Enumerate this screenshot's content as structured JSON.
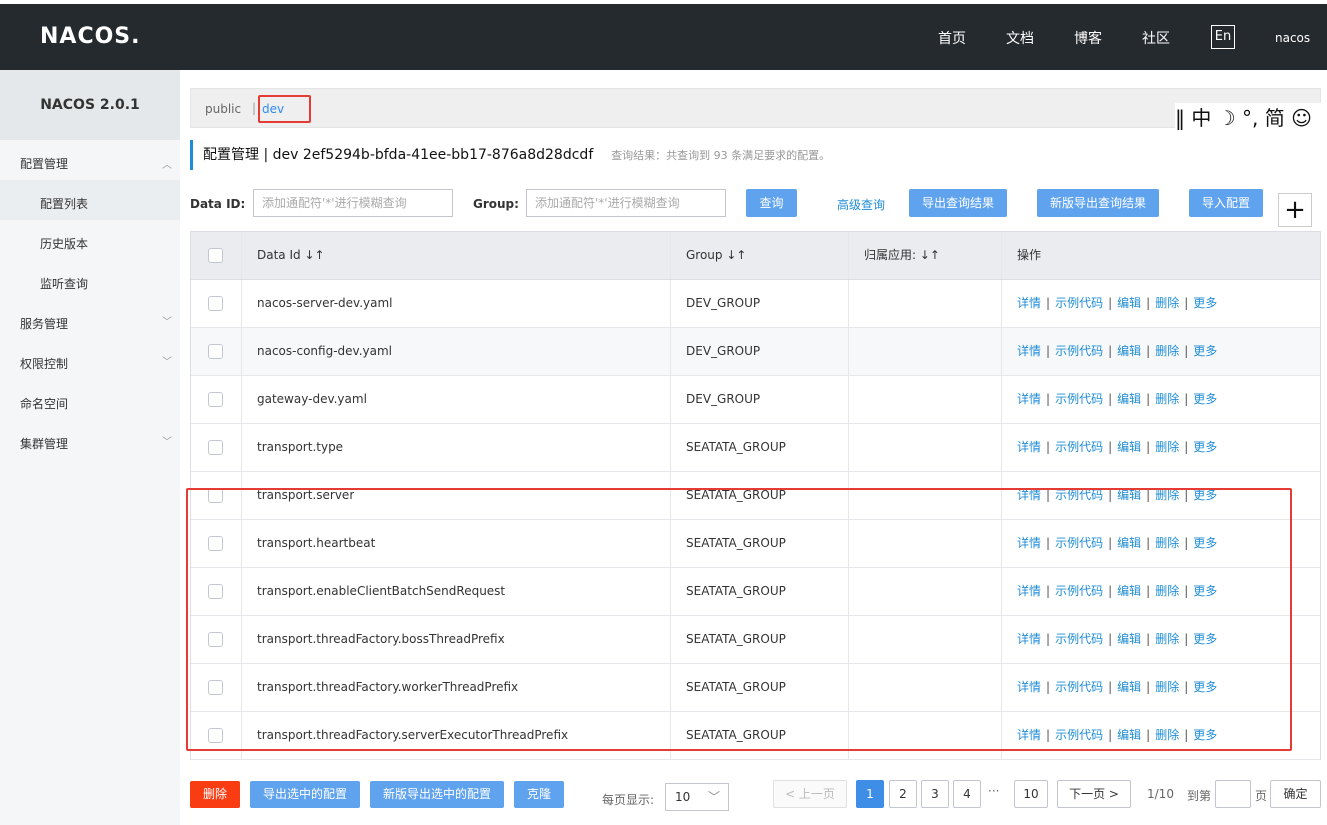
{
  "topbar": {
    "logo": "NACOS.",
    "nav": [
      "首页",
      "文档",
      "博客",
      "社区"
    ],
    "lang": "En",
    "user": "nacos"
  },
  "sidebar": {
    "version": "NACOS 2.0.1",
    "config_mgmt": "配置管理",
    "config_list": "配置列表",
    "history": "历史版本",
    "listen_query": "监听查询",
    "service_mgmt": "服务管理",
    "access_control": "权限控制",
    "namespace": "命名空间",
    "cluster_mgmt": "集群管理"
  },
  "namespaces": {
    "public": "public",
    "sep": "|",
    "dev": "dev"
  },
  "ime_toolbar": "‖ 中 ☽ °, 简 ☺",
  "title": {
    "main": "配置管理 | dev 2ef5294b-bfda-41ee-bb17-876a8d28dcdf",
    "hint": "查询结果：共查询到 93 条满足要求的配置。"
  },
  "search": {
    "dataid_label": "Data ID:",
    "dataid_placeholder": "添加通配符'*'进行模糊查询",
    "group_label": "Group:",
    "group_placeholder": "添加通配符'*'进行模糊查询",
    "query": "查询",
    "advanced": "高级查询",
    "export": "导出查询结果",
    "export_new": "新版导出查询结果",
    "import": "导入配置",
    "plus": "+"
  },
  "table": {
    "headers": {
      "dataid": "Data Id ↓↑",
      "group": "Group ↓↑",
      "app": "归属应用: ↓↑",
      "ops": "操作"
    },
    "op_labels": [
      "详情",
      "示例代码",
      "编辑",
      "删除",
      "更多"
    ],
    "rows": [
      {
        "dataid": "nacos-server-dev.yaml",
        "group": "DEV_GROUP"
      },
      {
        "dataid": "nacos-config-dev.yaml",
        "group": "DEV_GROUP"
      },
      {
        "dataid": "gateway-dev.yaml",
        "group": "DEV_GROUP"
      },
      {
        "dataid": "transport.type",
        "group": "SEATATA_GROUP"
      },
      {
        "dataid": "transport.server",
        "group": "SEATATA_GROUP"
      },
      {
        "dataid": "transport.heartbeat",
        "group": "SEATATA_GROUP"
      },
      {
        "dataid": "transport.enableClientBatchSendRequest",
        "group": "SEATATA_GROUP"
      },
      {
        "dataid": "transport.threadFactory.bossThreadPrefix",
        "group": "SEATATA_GROUP"
      },
      {
        "dataid": "transport.threadFactory.workerThreadPrefix",
        "group": "SEATATA_GROUP"
      },
      {
        "dataid": "transport.threadFactory.serverExecutorThreadPrefix",
        "group": "SEATATA_GROUP"
      }
    ]
  },
  "footer": {
    "delete": "删除",
    "export_selected": "导出选中的配置",
    "export_selected_new": "新版导出选中的配置",
    "clone": "克隆",
    "per_page_label": "每页显示:",
    "per_page": "10",
    "prev": "< 上一页",
    "pages": [
      "1",
      "2",
      "3",
      "4"
    ],
    "ellipsis": "···",
    "last_page": "10",
    "next": "下一页 >",
    "page_info": "1/10",
    "goto": "到第",
    "page_unit": "页",
    "confirm": "确定"
  }
}
